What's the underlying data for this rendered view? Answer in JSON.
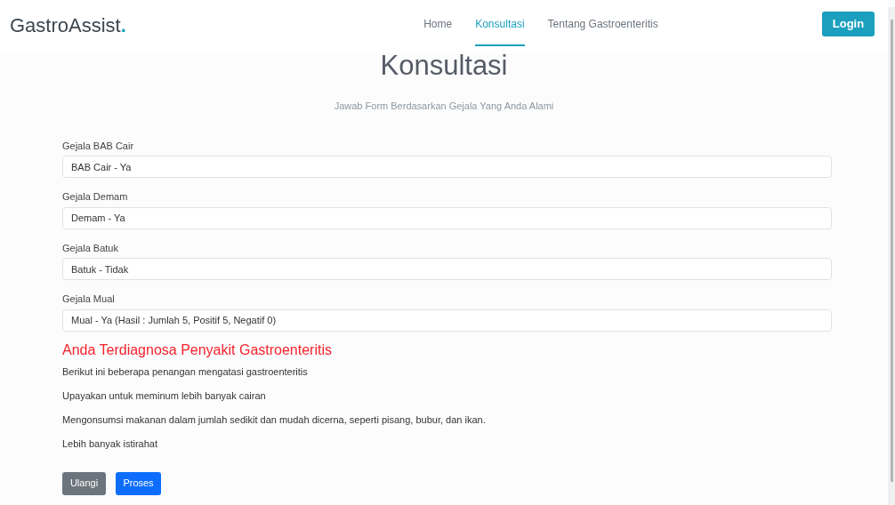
{
  "brand": {
    "name": "GastroAssist",
    "mark": "."
  },
  "nav": [
    {
      "label": "Home",
      "selected": false
    },
    {
      "label": "Konsultasi",
      "selected": true
    },
    {
      "label": "Tentang Gastroenteritis",
      "selected": false
    }
  ],
  "login_button": "Login",
  "title": "Konsultasi",
  "subtitle": "Jawab Form Berdasarkan Gejala Yang Anda Alami",
  "fields": [
    {
      "label": "Gejala BAB Cair",
      "value": "BAB Cair - Ya"
    },
    {
      "label": "Gejala Demam",
      "value": "Demam - Ya"
    },
    {
      "label": "Gejala Batuk",
      "value": "Batuk - Tidak"
    },
    {
      "label": "Gejala Mual",
      "value": "Mual - Ya (Hasil : Jumlah 5, Positif 5, Negatif 0)"
    }
  ],
  "result": {
    "heading": "Anda Terdiagnosa Penyakit Gastroenteritis",
    "paragraphs": [
      "Berikut ini beberapa penangan mengatasi gastroenteritis",
      "Upayakan untuk meminum lebih banyak cairan",
      "Mengonsumsi makanan dalam jumlah sedikit dan mudah dicerna, seperti pisang, bubur, dan ikan.",
      "Lebih banyak istirahat"
    ]
  },
  "buttons": [
    {
      "label": "Ulangi",
      "kind": "secondary"
    },
    {
      "label": "Proses",
      "kind": "primary"
    }
  ]
}
